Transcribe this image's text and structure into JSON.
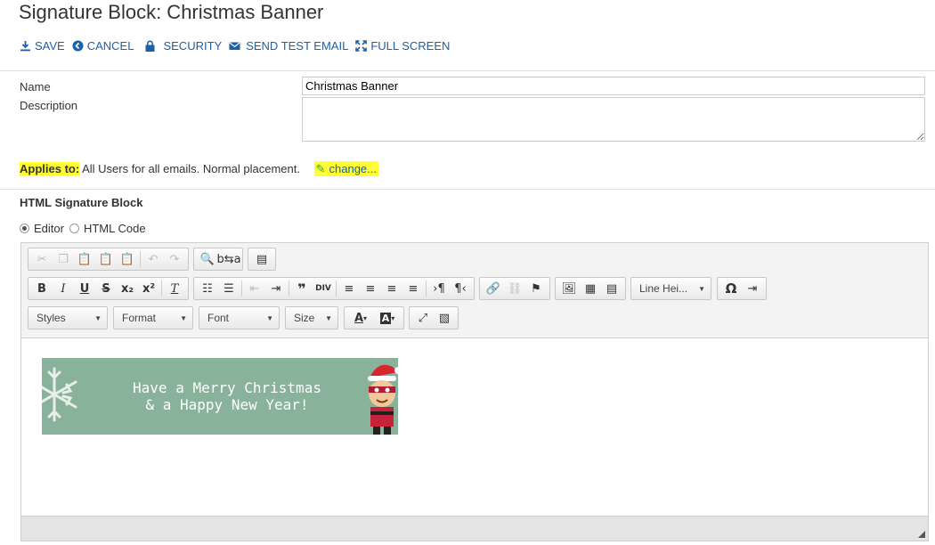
{
  "page": {
    "title": "Signature Block: Christmas Banner"
  },
  "actions": [
    {
      "label": "SAVE",
      "icon": "download-icon"
    },
    {
      "label": "CANCEL",
      "icon": "back-arrow-icon"
    },
    {
      "label": "SECURITY",
      "icon": "lock-icon"
    },
    {
      "label": "SEND TEST EMAIL",
      "icon": "envelope-icon"
    },
    {
      "label": "FULL SCREEN",
      "icon": "expand-icon"
    }
  ],
  "form": {
    "name_label": "Name",
    "name_value": "Christmas Banner",
    "description_label": "Description",
    "description_value": ""
  },
  "applies": {
    "label": "Applies to:",
    "text": "All Users for all emails. Normal placement.",
    "change_label": "change..."
  },
  "section": {
    "title": "HTML Signature Block",
    "mode_editor": "Editor",
    "mode_html": "HTML Code",
    "selected": "Editor"
  },
  "toolbar": {
    "combos": {
      "line_height": "Line Hei...",
      "styles": "Styles",
      "format": "Format",
      "font": "Font",
      "size": "Size"
    }
  },
  "banner": {
    "line1": "Have a Merry Christmas",
    "line2": "& a Happy New Year!"
  },
  "colors": {
    "link": "#1f5fa3",
    "highlight": "#ffff33",
    "banner_bg": "#89b29b"
  }
}
